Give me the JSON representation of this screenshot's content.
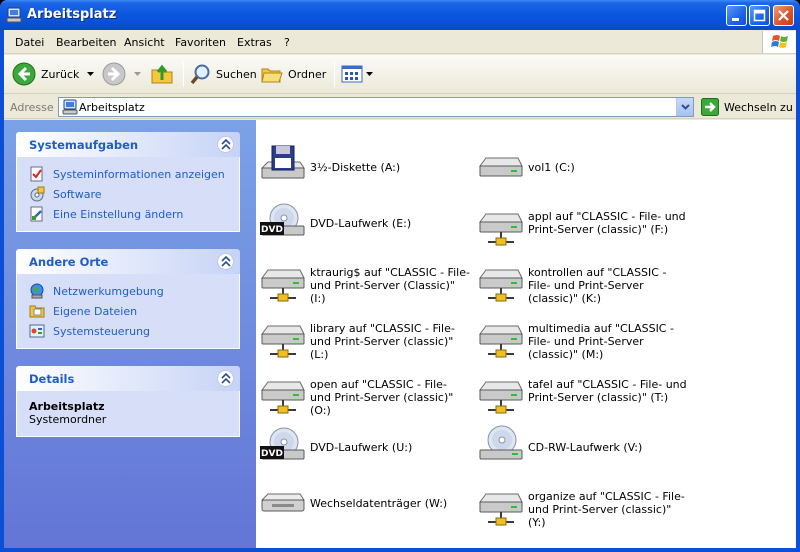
{
  "window": {
    "title": "Arbeitsplatz"
  },
  "menu": [
    "Datei",
    "Bearbeiten",
    "Ansicht",
    "Favoriten",
    "Extras",
    "?"
  ],
  "toolbar": {
    "back_label": "Zurück",
    "search_label": "Suchen",
    "folders_label": "Ordner"
  },
  "address": {
    "label": "Adresse",
    "value": "Arbeitsplatz",
    "go_label": "Wechseln zu"
  },
  "taskpane": {
    "system_tasks": {
      "title": "Systemaufgaben",
      "items": [
        {
          "label": "Systeminformationen anzeigen",
          "icon": "system-info-icon"
        },
        {
          "label": "Software",
          "icon": "software-icon"
        },
        {
          "label": "Eine Einstellung ändern",
          "icon": "settings-icon"
        }
      ]
    },
    "other_places": {
      "title": "Andere Orte",
      "items": [
        {
          "label": "Netzwerkumgebung",
          "icon": "network-icon"
        },
        {
          "label": "Eigene Dateien",
          "icon": "folder-icon"
        },
        {
          "label": "Systemsteuerung",
          "icon": "control-panel-icon"
        }
      ]
    },
    "details": {
      "title": "Details",
      "name": "Arbeitsplatz",
      "type": "Systemordner"
    }
  },
  "drives": [
    {
      "label": "3½-Diskette (A:)",
      "icon": "floppy-icon"
    },
    {
      "label": "vol1 (C:)",
      "icon": "hard-drive-icon"
    },
    {
      "label": "DVD-Laufwerk (E:)",
      "icon": "dvd-drive-icon"
    },
    {
      "label": "appl auf \"CLASSIC - File- und Print-Server (classic)\" (F:)",
      "icon": "network-drive-icon"
    },
    {
      "label": "ktraurig$ auf \"CLASSIC - File- und Print-Server (Classic)\" (I:)",
      "icon": "network-drive-icon"
    },
    {
      "label": "kontrollen auf \"CLASSIC - File- und Print-Server (classic)\" (K:)",
      "icon": "network-drive-icon"
    },
    {
      "label": "library auf \"CLASSIC - File- und Print-Server (classic)\" (L:)",
      "icon": "network-drive-icon"
    },
    {
      "label": "multimedia auf \"CLASSIC - File- und Print-Server (classic)\" (M:)",
      "icon": "network-drive-icon"
    },
    {
      "label": "open auf \"CLASSIC - File- und Print-Server (classic)\" (O:)",
      "icon": "network-drive-icon"
    },
    {
      "label": "tafel auf \"CLASSIC - File- und Print-Server (classic)\" (T:)",
      "icon": "network-drive-icon"
    },
    {
      "label": "DVD-Laufwerk (U:)",
      "icon": "dvd-drive-icon"
    },
    {
      "label": "CD-RW-Laufwerk (V:)",
      "icon": "cd-drive-icon"
    },
    {
      "label": "Wechseldatenträger (W:)",
      "icon": "removable-drive-icon"
    },
    {
      "label": "organize auf \"CLASSIC - File- und Print-Server (classic)\" (Y:)",
      "icon": "network-drive-icon"
    }
  ],
  "dvd_badge": "DVD"
}
